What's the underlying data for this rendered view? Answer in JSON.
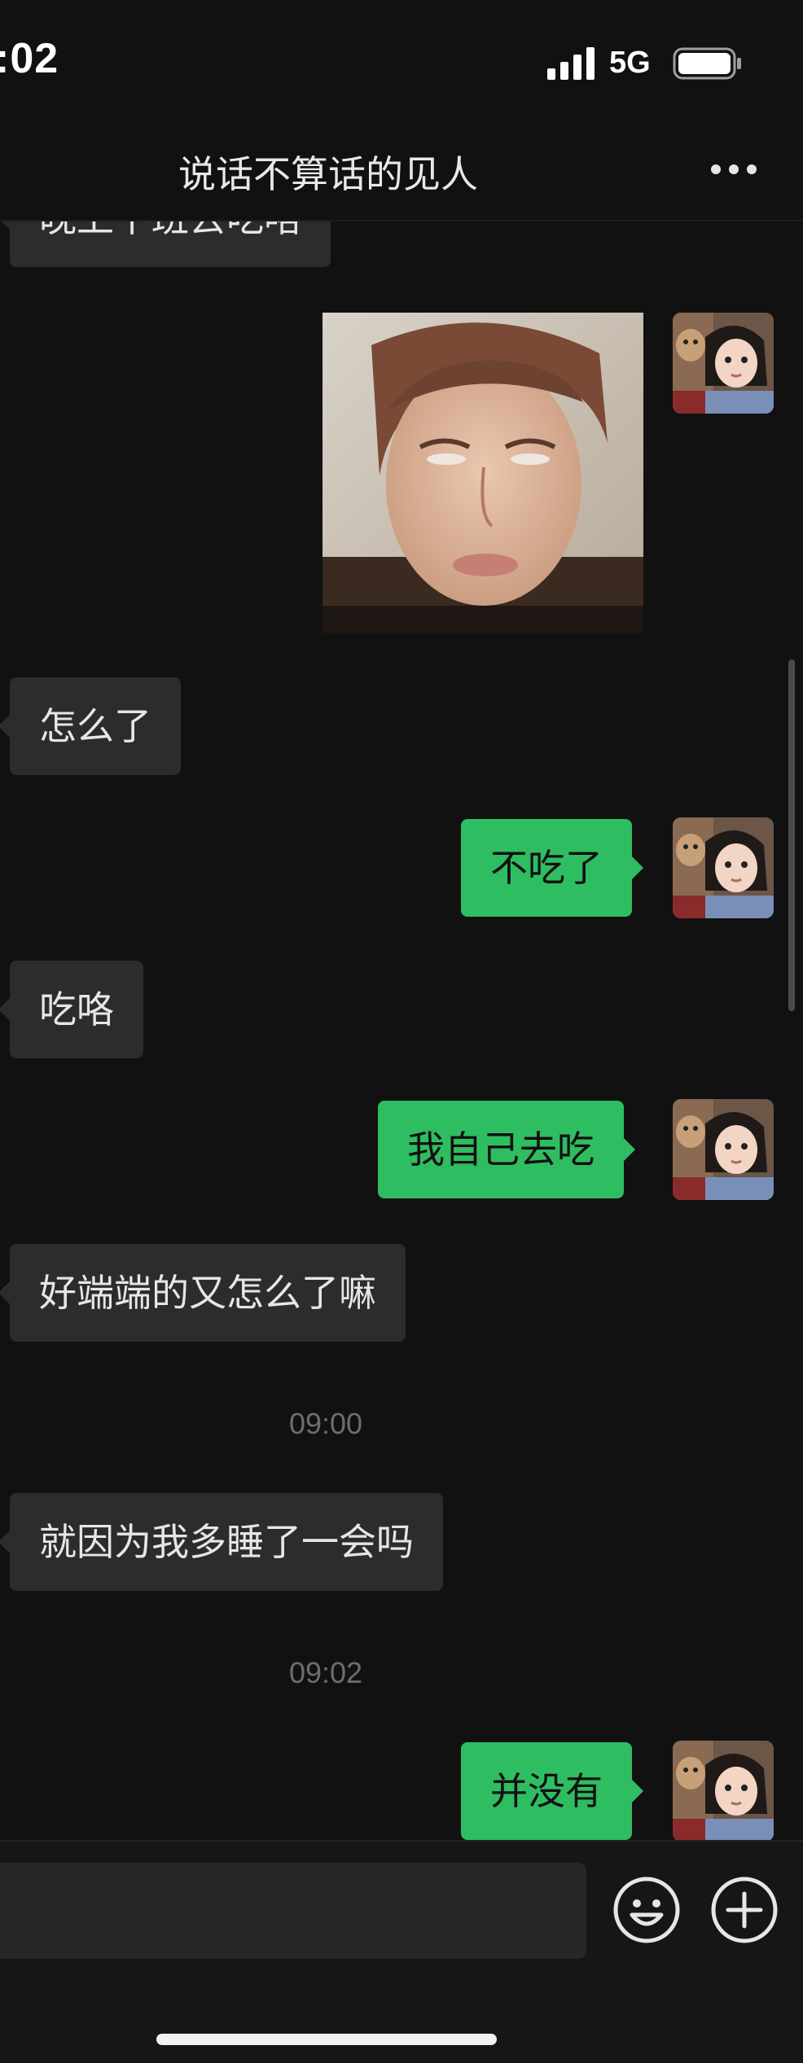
{
  "status_bar": {
    "time": ":02",
    "network": "5G",
    "signal_icon": "signal-bars-icon",
    "battery_icon": "battery-icon"
  },
  "header": {
    "title": "说话不算话的见人",
    "more_icon": "more-dots-icon"
  },
  "messages": {
    "m0": "晚上下班去吃咯",
    "m1_sticker": "face-sticker-image",
    "m2": "怎么了",
    "m3": "不吃了",
    "m4": "吃咯",
    "m5": "我自己去吃",
    "m6": "好端端的又怎么了嘛",
    "ts1": "09:00",
    "m7": "就因为我多睡了一会吗",
    "ts2": "09:02",
    "m8": "并没有"
  },
  "input_bar": {
    "placeholder": "",
    "emoji_icon": "emoji-icon",
    "add_icon": "plus-icon"
  },
  "colors": {
    "background": "#111111",
    "incoming_bubble": "#2c2c2c",
    "outgoing_bubble": "#2fbd62",
    "timestamp": "#6d6d6d"
  }
}
